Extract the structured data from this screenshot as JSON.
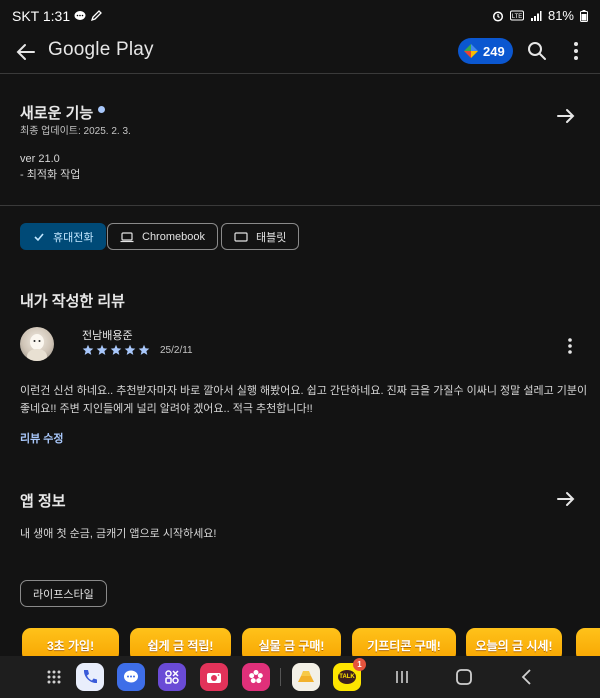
{
  "status_bar": {
    "carrier_time": "SKT 1:31",
    "battery": "81%"
  },
  "app_bar": {
    "title": "Google Play",
    "points": "249"
  },
  "whats_new": {
    "title": "새로운 기능",
    "updated": "최종 업데이트: 2025. 2. 3.",
    "version": "ver 21.0",
    "note": "- 최적화 작업"
  },
  "devices": [
    {
      "label": "휴대전화",
      "selected": true,
      "icon": "check-icon"
    },
    {
      "label": "Chromebook",
      "selected": false,
      "icon": "laptop-icon"
    },
    {
      "label": "태블릿",
      "selected": false,
      "icon": "tablet-icon"
    }
  ],
  "my_review": {
    "title": "내가 작성한 리뷰",
    "author": "전남배용준",
    "rating": 5,
    "date": "25/2/11",
    "text_line1": "이런건 신선 하네요.. 추천받자마자 바로 깔아서 실행 해봤어요. 쉽고 간단하네요. 진짜 금을 가질수 이싸니 정말 설레고 기분이",
    "text_line2": "좋네요!! 주변 지인들에게 널리 알려야 겠어요.. 적극 추천합니다!!",
    "edit_label": "리뷰 수정"
  },
  "app_info": {
    "title": "앱 정보",
    "description": "내 생애 첫 순금, 금캐기 앱으로 시작하세요!",
    "category": "라이프스타일"
  },
  "promos": [
    "3초 가입!",
    "쉽게 금 적립!",
    "실물 금 구매!",
    "기프티콘 구매!",
    "오늘의 금 시세!"
  ],
  "nav": {
    "talk_badge": "1",
    "talk_label": "TALK"
  },
  "colors": {
    "background": "#131313",
    "accent_blue": "#a8c7fa",
    "chip_selected_bg": "#004a77",
    "promo_yellow": "#ffc21a",
    "points_bg": "#0b57d0"
  }
}
